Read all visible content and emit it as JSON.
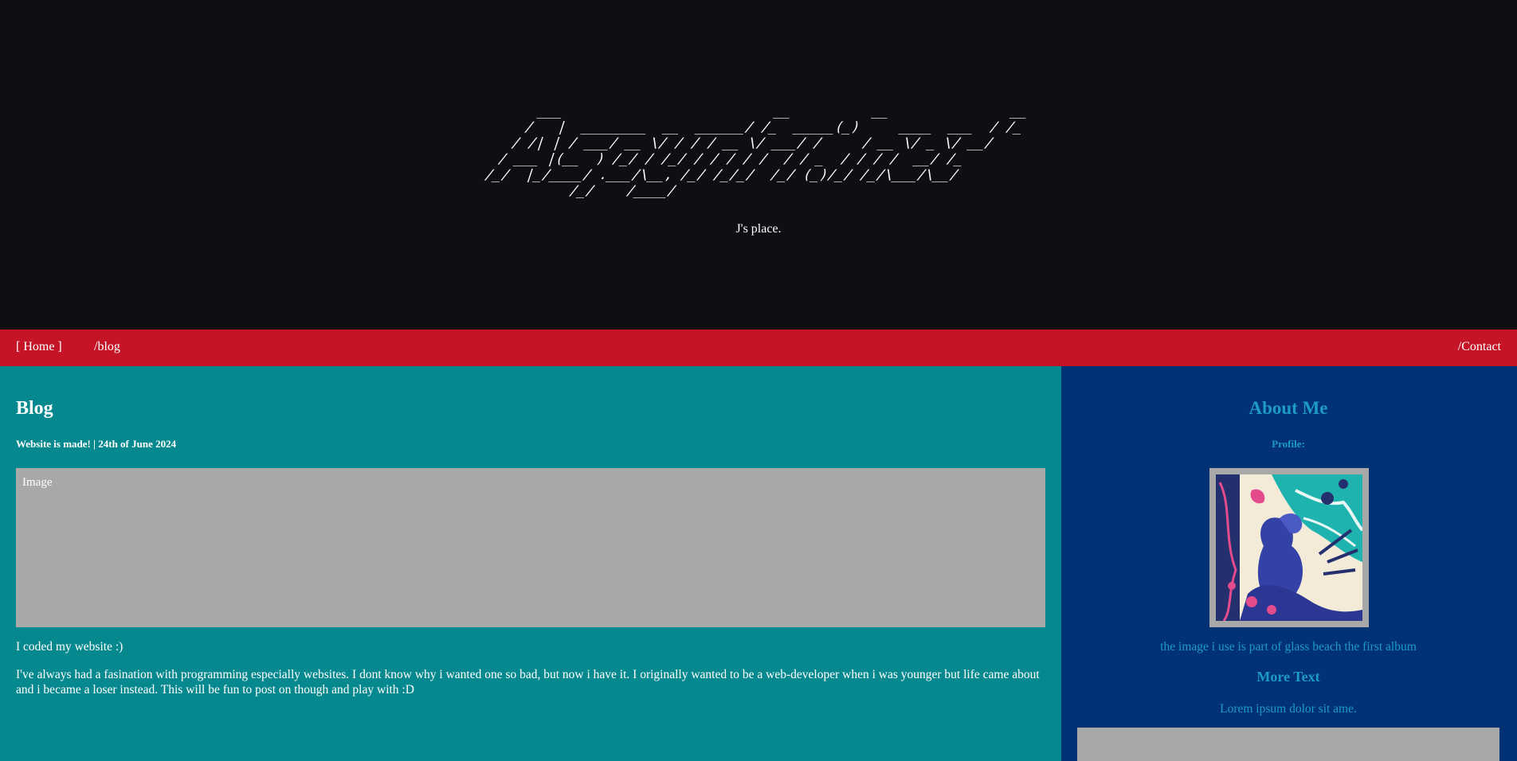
{
  "site": {
    "ascii_logo": "    ___                          __          __               __ \n   /   |  ________  __  ______/ /_  _____(_)     ____  ___  / /_\n  / /| | / ___/ __ \\/ / / / __ \\/ ___/ /     / __ \\/ _ \\/ __/\n / ___ |(__  ) /_/ / /_/ / / / / /  / / _  / / / /  __/ /_  \n/_/  |_/____/ .___/\\__, /_/ /_/_/  /_/ (_)/_/ /_/\\___/\\__/  \n           /_/    /____/                                       ",
    "tagline": "J's place."
  },
  "nav": {
    "home": "[ Home ]",
    "blog": "/blog",
    "contact": "/Contact"
  },
  "blog": {
    "title": "Blog",
    "post_heading": "Website is made! | 24th of June 2024",
    "image_label": "Image",
    "intro": "I coded my website :)",
    "body": "I've always had a fasination with programming especially websites. I dont know why i wanted one so bad, but now i have it. I originally wanted to be a web-developer when i was younger but life came about and i became a loser instead. This will be fun to post on though and play with :D"
  },
  "about": {
    "title": "About Me",
    "profile_label": "Profile:",
    "caption": "the image i use is part of glass beach the first album",
    "more_title": "More Text",
    "lorem": "Lorem ipsum dolor sit ame."
  },
  "colors": {
    "header_bg": "#0e0f13",
    "nav_bg": "#c41426",
    "main_bg": "#05888e",
    "aside_bg": "#003275",
    "aside_text": "#1e9bc4",
    "placeholder_grey": "#a8a8a8"
  }
}
